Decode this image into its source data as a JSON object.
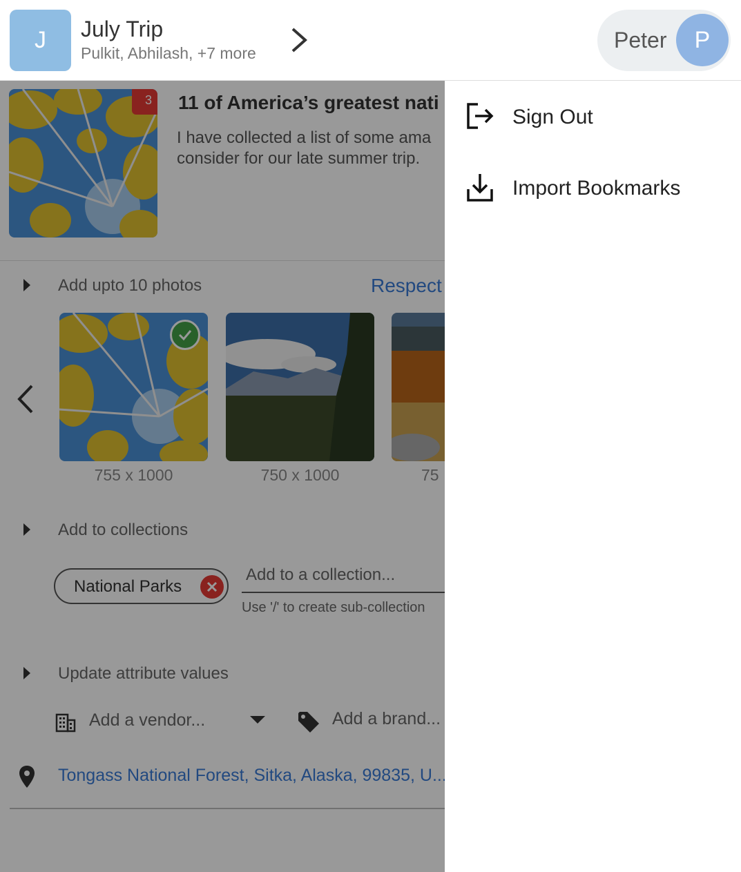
{
  "header": {
    "trip_initial": "J",
    "trip_title": "July Trip",
    "trip_members": "Pulkit, Abhilash, +7 more",
    "user_name": "Peter",
    "user_initial": "P"
  },
  "bookmark": {
    "badge_count": "3",
    "title": "11 of America’s greatest nati",
    "description": "I have collected a list of some ama consider for our late summer trip."
  },
  "photos_section": {
    "label": "Add upto 10 photos",
    "link": "Respect",
    "items": [
      {
        "size": "755 x 1000",
        "selected": true
      },
      {
        "size": "750 x 1000",
        "selected": false
      },
      {
        "size": "75",
        "selected": false
      }
    ]
  },
  "collections_section": {
    "label": "Add to collections",
    "chips": [
      "National Parks"
    ],
    "input_placeholder": "Add to a collection...",
    "hint": "Use '/' to create sub-collection"
  },
  "attributes_section": {
    "label": "Update attribute values",
    "vendor_placeholder": "Add a vendor...",
    "brand_placeholder": "Add a brand..."
  },
  "location": "Tongass National Forest, Sitka, Alaska, 99835, U...",
  "menu": {
    "items": [
      {
        "label": "Sign Out",
        "icon": "sign-out-icon"
      },
      {
        "label": "Import Bookmarks",
        "icon": "download-icon"
      }
    ]
  },
  "colors": {
    "trip_avatar": "#8fbde3",
    "user_avatar": "#8fb4e3",
    "badge": "#e53935",
    "link": "#3a7bd5",
    "check": "#43a047"
  }
}
